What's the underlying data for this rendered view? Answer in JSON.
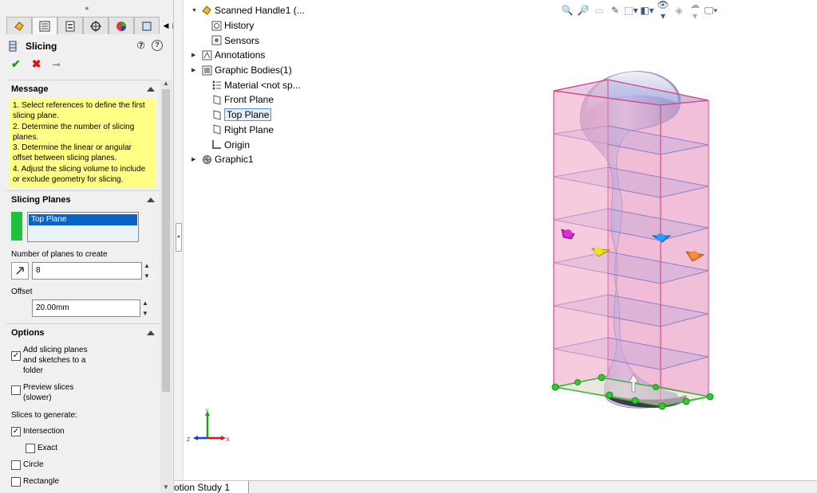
{
  "panel": {
    "title": "Slicing",
    "tabs": [
      "featuremanager-icon",
      "propertymanager-icon",
      "configurationmanager-icon",
      "dimxpert-icon",
      "display-manager-icon",
      "custom-tab-icon"
    ],
    "message": {
      "heading": "Message",
      "lines": [
        "1. Select references to define the first",
        "slicing plane.",
        "2. Determine the number of slicing",
        "planes.",
        "3. Determine the linear or angular",
        "offset between slicing planes.",
        "4. Adjust the slicing volume to include",
        "or exclude geometry for slicing."
      ]
    },
    "slicing_planes": {
      "heading": "Slicing Planes",
      "selected": "Top Plane",
      "num_label": "Number of planes to create",
      "num_value": "8",
      "offset_label": "Offset",
      "offset_value": "20.00mm"
    },
    "options": {
      "heading": "Options",
      "add_to_folder_1": "Add slicing planes",
      "add_to_folder_2": "and sketches to a",
      "add_to_folder_3": "folder",
      "preview_1": "Preview slices",
      "preview_2": "(slower)",
      "slices_label": "Slices to generate:",
      "intersection": "Intersection",
      "exact": "Exact",
      "circle": "Circle",
      "rectangle": "Rectangle"
    }
  },
  "tree": {
    "root": "Scanned Handle1  (...",
    "items": [
      {
        "label": "History"
      },
      {
        "label": "Sensors"
      },
      {
        "label": "Annotations"
      },
      {
        "label": "Graphic Bodies(1)"
      },
      {
        "label": "Material <not sp..."
      },
      {
        "label": "Front Plane"
      },
      {
        "label": "Top Plane"
      },
      {
        "label": "Right Plane"
      },
      {
        "label": "Origin"
      },
      {
        "label": "Graphic1"
      }
    ]
  },
  "bottom": {
    "motion_tab": "otion Study 1"
  },
  "colors": {
    "selection_blue": "#0a64c8",
    "message_yellow": "#ffff85",
    "slice_box_pink": "#e8599a",
    "handle_lavender": "#c9b2de",
    "accent_green": "#1ec13a"
  }
}
